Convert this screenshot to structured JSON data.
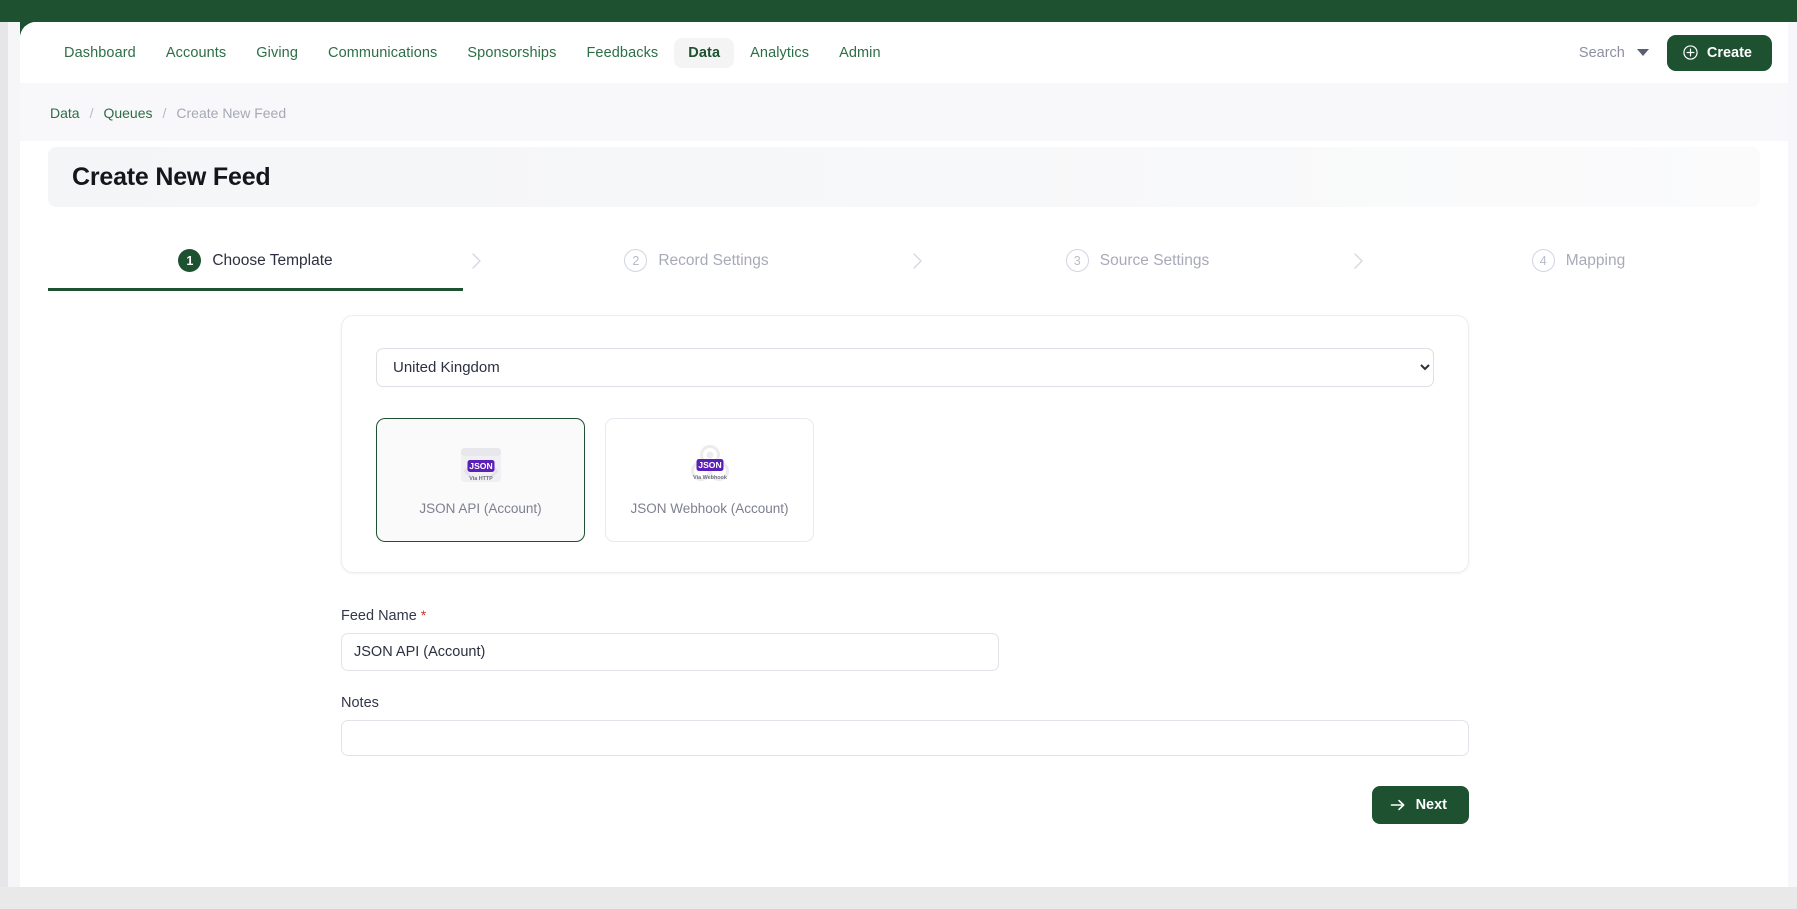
{
  "theme": {
    "brand_green": "#1d5130",
    "nav_link_green": "#2c6e45",
    "muted_text": "#a8aab8",
    "required_red": "#d0342c",
    "json_badge_purple": "#5b20b8"
  },
  "nav": {
    "items": [
      {
        "label": "Dashboard",
        "active": false
      },
      {
        "label": "Accounts",
        "active": false
      },
      {
        "label": "Giving",
        "active": false
      },
      {
        "label": "Communications",
        "active": false
      },
      {
        "label": "Sponsorships",
        "active": false
      },
      {
        "label": "Feedbacks",
        "active": false
      },
      {
        "label": "Data",
        "active": true
      },
      {
        "label": "Analytics",
        "active": false
      },
      {
        "label": "Admin",
        "active": false
      }
    ],
    "search_label": "Search",
    "create_label": "Create",
    "search_icon": "chevron-down-icon",
    "create_icon": "plus-circle-icon"
  },
  "breadcrumb": {
    "items": [
      {
        "label": "Data",
        "current": false
      },
      {
        "label": "Queues",
        "current": false
      },
      {
        "label": "Create New Feed",
        "current": true
      }
    ],
    "separator": "/"
  },
  "header": {
    "title": "Create New Feed"
  },
  "stepper": {
    "steps": [
      {
        "number": "1",
        "label": "Choose Template",
        "active": true
      },
      {
        "number": "2",
        "label": "Record Settings",
        "active": false
      },
      {
        "number": "3",
        "label": "Source Settings",
        "active": false
      },
      {
        "number": "4",
        "label": "Mapping",
        "active": false
      }
    ],
    "separator_icon": "chevron-right-icon"
  },
  "template_panel": {
    "country_select": {
      "value": "United Kingdom",
      "options": [
        "United Kingdom"
      ]
    },
    "cards": [
      {
        "title": "JSON API (Account)",
        "badge": "JSON",
        "sub_badge": "Via HTTP",
        "icon": "browser-window-code-icon",
        "selected": true
      },
      {
        "title": "JSON Webhook (Account)",
        "badge": "JSON",
        "sub_badge": "Via Webhook",
        "icon": "webhook-nodes-icon",
        "selected": false
      }
    ]
  },
  "form": {
    "feed_name": {
      "label": "Feed Name",
      "required_marker": "*",
      "value": "JSON API (Account)",
      "placeholder": ""
    },
    "notes": {
      "label": "Notes",
      "value": "",
      "placeholder": ""
    },
    "next_label": "Next",
    "next_icon": "arrow-right-icon"
  }
}
